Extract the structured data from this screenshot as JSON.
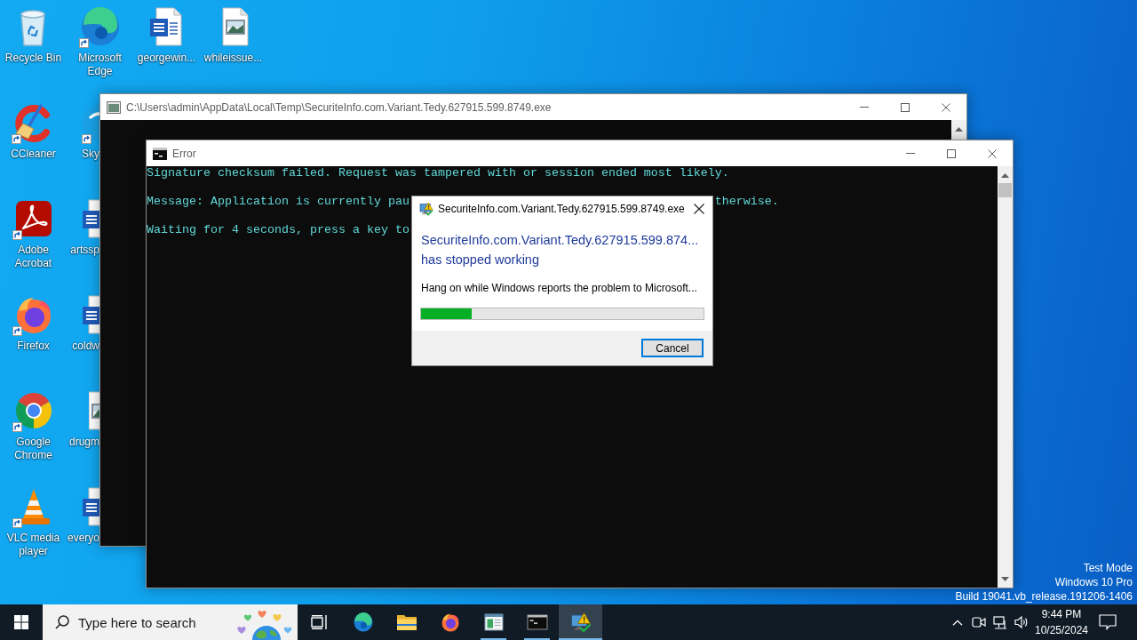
{
  "desktop": {
    "icon_rows": [
      {
        "icons": [
          {
            "label": "Recycle Bin",
            "shortcut": false
          },
          {
            "label": "Microsoft Edge",
            "shortcut": true
          },
          {
            "label": "georgewin...",
            "shortcut": false
          },
          {
            "label": "whileissue...",
            "shortcut": false
          }
        ]
      },
      {
        "icons": [
          {
            "label": "CCleaner",
            "shortcut": true
          },
          {
            "label": "Sky",
            "shortcut": true
          }
        ]
      },
      {
        "icons": [
          {
            "label": "Adobe Acrobat",
            "shortcut": true
          },
          {
            "label": "artssp",
            "shortcut": false
          }
        ]
      },
      {
        "icons": [
          {
            "label": "Firefox",
            "shortcut": true
          },
          {
            "label": "coldw",
            "shortcut": false
          }
        ]
      },
      {
        "icons": [
          {
            "label": "Google Chrome",
            "shortcut": true
          },
          {
            "label": "drugm",
            "shortcut": false
          }
        ]
      },
      {
        "icons": [
          {
            "label": "VLC media player",
            "shortcut": true
          },
          {
            "label": "everyo",
            "shortcut": false
          }
        ]
      }
    ],
    "system_info": [
      "Test Mode",
      "Windows 10 Pro",
      "Build 19041.vb_release.191206-1406"
    ]
  },
  "windows": [
    {
      "title": "C:\\Users\\admin\\AppData\\Local\\Temp\\SecuriteInfo.com.Variant.Tedy.627915.599.8749.exe"
    },
    {
      "title": "Error",
      "lines": [
        [
          "Signature checksum failed. Request was tampered with or session ended most likely."
        ],
        [
          "Message: Application is currently pau",
          "therwise."
        ],
        [
          "Waiting for 4 seconds, press a key to"
        ]
      ]
    }
  ],
  "dialog": {
    "title": "SecuriteInfo.com.Variant.Tedy.627915.599.8749.exe",
    "heading": "SecuriteInfo.com.Variant.Tedy.627915.599.874...\nhas stopped working",
    "message": "Hang on while Windows reports the problem to Microsoft...",
    "progress": {
      "level": 0.18
    },
    "buttons": [
      {
        "label": "Cancel",
        "default": true
      }
    ]
  },
  "taskbar": {
    "search": {
      "placeholder": "Type here to search"
    },
    "apps": [
      {
        "running": false,
        "selected": false
      },
      {
        "running": false,
        "selected": false
      },
      {
        "running": false,
        "selected": false
      },
      {
        "running": true,
        "selected": false
      },
      {
        "running": true,
        "selected": false
      },
      {
        "running": true,
        "selected": true
      }
    ],
    "clock": {
      "time": "9:44 PM",
      "date": "10/25/2024"
    }
  }
}
